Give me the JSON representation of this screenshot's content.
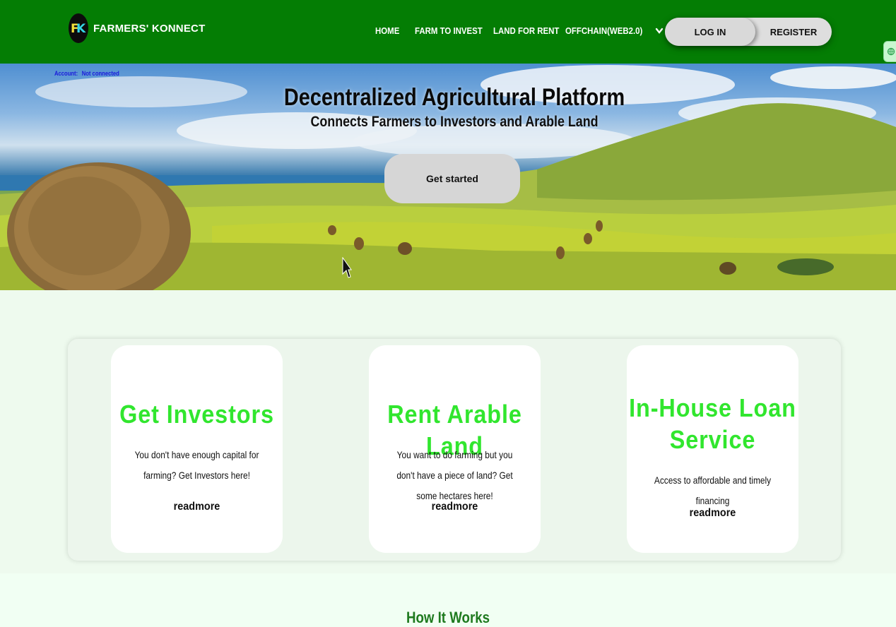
{
  "navbar": {
    "brand": "FARMERS' KONNECT",
    "logo_letters": "FK",
    "links": [
      "HOME",
      "FARM TO INVEST",
      "LAND FOR RENT",
      "OFFCHAIN(WEB2.0)"
    ],
    "login_label": "LOG IN",
    "register_label": "REGISTER"
  },
  "account": {
    "label": "Account:",
    "status": "Not connected"
  },
  "hero": {
    "title": "Decentralized Agricultural Platform",
    "subtitle": "Connects Farmers to Investors and Arable Land",
    "cta_label": "Get started"
  },
  "services": [
    {
      "title": "Get Investors",
      "text": "You don't have enough capital for farming? Get Investors here!",
      "link": "readmore"
    },
    {
      "title": "Rent Arable Land",
      "text": "You want to do farming but you don't have a piece of land? Get some hectares here!",
      "link": "readmore"
    },
    {
      "title": "In-House Loan Service",
      "text": "Access to affordable and timely financing",
      "link": "readmore"
    }
  ],
  "how_it_works": {
    "title": "How It Works"
  },
  "colors": {
    "nav_green": "#047d04",
    "accent_green": "#31e62e",
    "page_bg": "#eefaee"
  },
  "icons": [
    "chevron-down-icon",
    "cursor-icon",
    "network-icon"
  ]
}
